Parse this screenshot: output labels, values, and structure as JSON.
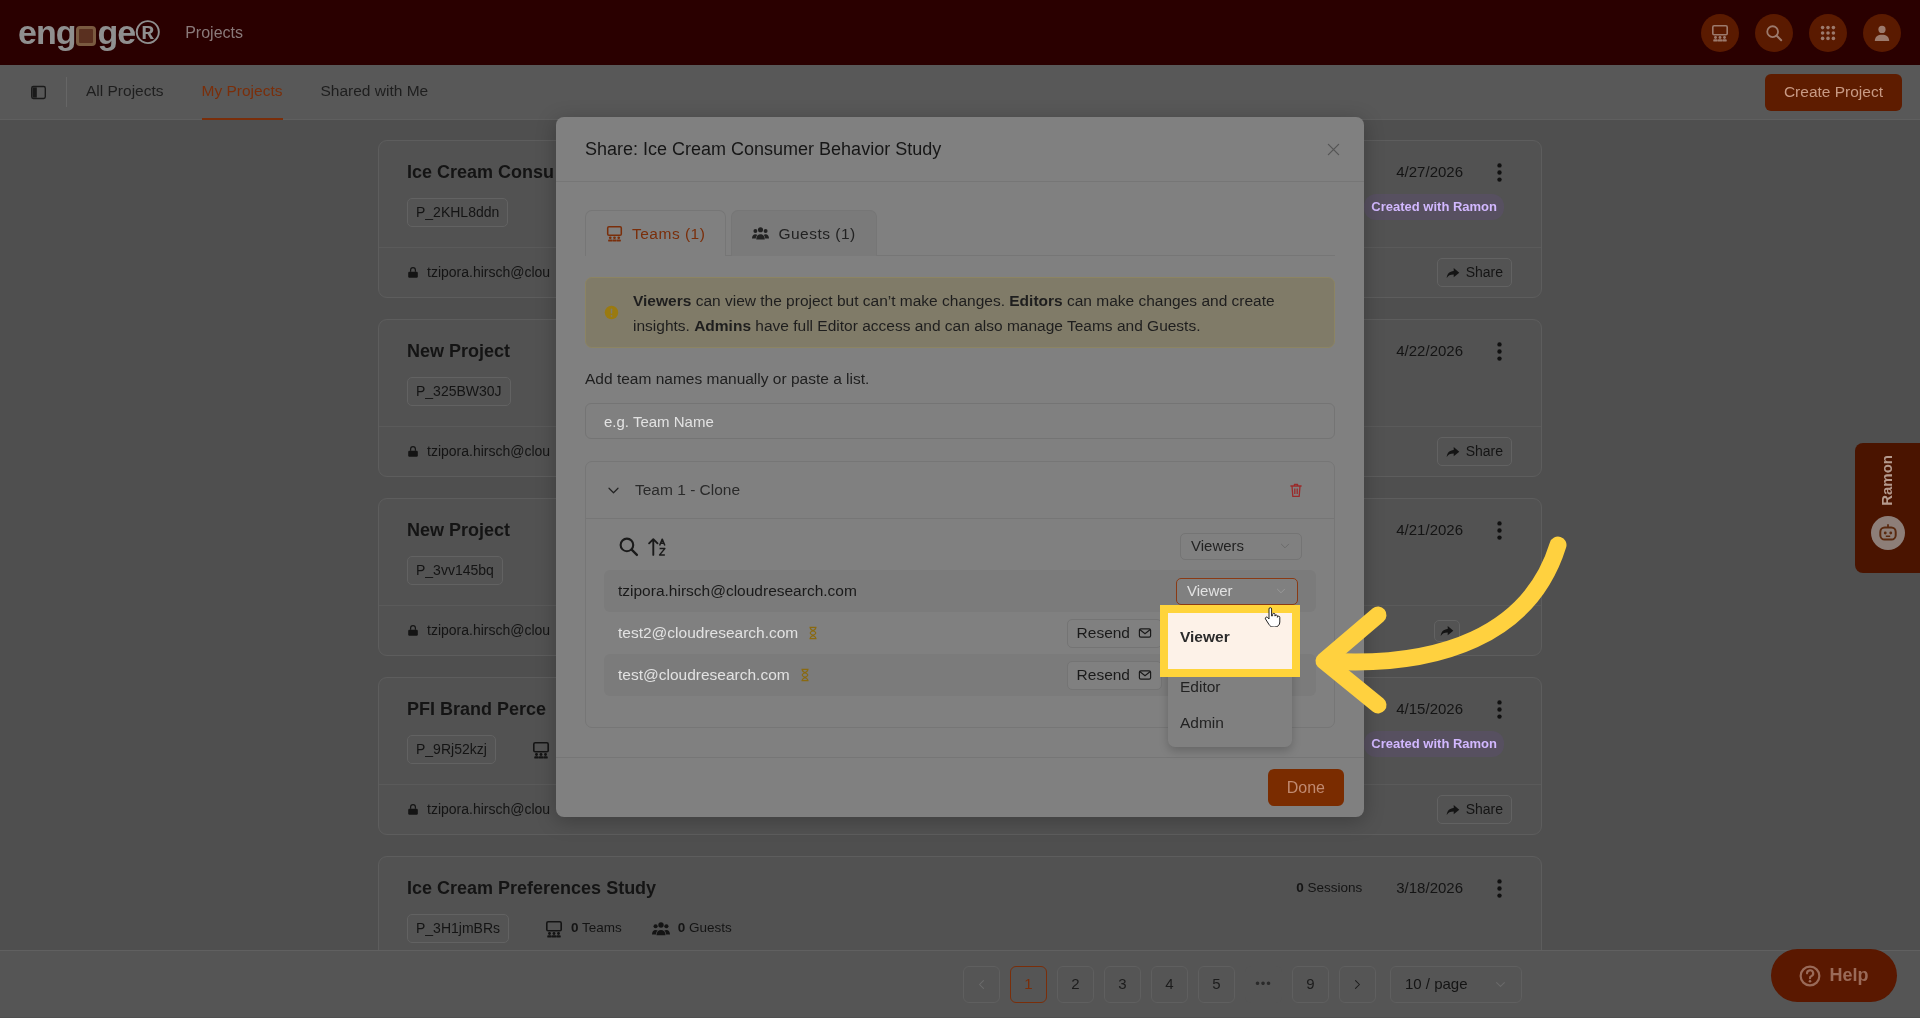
{
  "top_bar": {
    "logo": {
      "start": "eng",
      "end": "ge®"
    },
    "title": "Projects",
    "icons": [
      {
        "kind": "teams"
      },
      {
        "kind": "search"
      },
      {
        "kind": "apps"
      },
      {
        "kind": "user"
      }
    ]
  },
  "nav": {
    "tabs": [
      {
        "label": "All Projects",
        "selected": false
      },
      {
        "label": "My Projects",
        "selected": true
      },
      {
        "label": "Shared with Me",
        "selected": false
      }
    ],
    "create_button": "Create Project"
  },
  "projects": [
    {
      "title": "Ice Cream Consu",
      "code": "P_2KHL8ddn",
      "owner": "tzipora.hirsch@clou",
      "date": "4/27/2026",
      "tag": "Created with Ramon",
      "share": "Share"
    },
    {
      "title": "New Project",
      "code": "P_325BW30J",
      "owner": "tzipora.hirsch@clou",
      "date": "4/22/2026",
      "share": "Share"
    },
    {
      "title": "New Project",
      "code": "P_3vv145bq",
      "owner": "tzipora.hirsch@clou",
      "date": "4/21/2026",
      "share_icon_only": true
    },
    {
      "title": "PFI Brand Perce",
      "code": "P_9Rj52kzj",
      "stats": [
        {
          "kind": "teams"
        }
      ],
      "owner": "tzipora.hirsch@clou",
      "date": "4/15/2026",
      "tag": "Created with Ramon",
      "share": "Share"
    },
    {
      "title": "Ice Cream Preferences Study",
      "code": "P_3H1jmBRs",
      "stats": [
        {
          "kind": "teams",
          "count": "0",
          "label": "Teams"
        },
        {
          "kind": "guests",
          "count": "0",
          "label": "Guests"
        }
      ],
      "sessions": {
        "count": "0",
        "label": "Sessions"
      },
      "date": "3/18/2026"
    }
  ],
  "pagination": {
    "pages": [
      {
        "label": "1",
        "selected": true
      },
      {
        "label": "2",
        "selected": false
      },
      {
        "label": "3",
        "selected": false
      },
      {
        "label": "4",
        "selected": false
      },
      {
        "label": "5",
        "selected": false
      },
      {
        "label": "•••",
        "kind": "ellipsis"
      },
      {
        "label": "9",
        "selected": false
      }
    ],
    "page_size": "10 / page"
  },
  "help_button": "Help",
  "side_tab": {
    "label": "Ramon"
  },
  "share_dialog": {
    "title": "Share: Ice Cream Consumer Behavior Study",
    "tabs": [
      {
        "label": "Teams (1)",
        "kind": "teams",
        "selected": true
      },
      {
        "label": "Guests (1)",
        "kind": "guests",
        "selected": false
      }
    ],
    "notice": "**Viewers** can view the project but can’t make changes. **Editors** can make changes and create insights. **Admins** have full Editor access and can also manage Teams and Guests.",
    "field_label": "Add team names manually or paste a list.",
    "team_field": {
      "placeholder": "e.g. Team Name"
    },
    "teams": [
      {
        "name": "Team 1 - Clone",
        "expanded": true,
        "role_filter": "Viewers",
        "members": [
          {
            "email": "tzipora.hirsch@cloudresearch.com",
            "pending": false,
            "role": "Viewer",
            "menu_open": true
          },
          {
            "email": "test2@cloudresearch.com",
            "pending": true,
            "resend": "Resend"
          },
          {
            "email": "test@cloudresearch.com",
            "pending": true,
            "resend": "Resend"
          }
        ]
      }
    ],
    "role_menu": [
      {
        "label": "Viewer",
        "selected": true
      },
      {
        "label": "Editor",
        "selected": false
      },
      {
        "label": "Admin",
        "selected": false
      }
    ],
    "done_button": "Done"
  }
}
